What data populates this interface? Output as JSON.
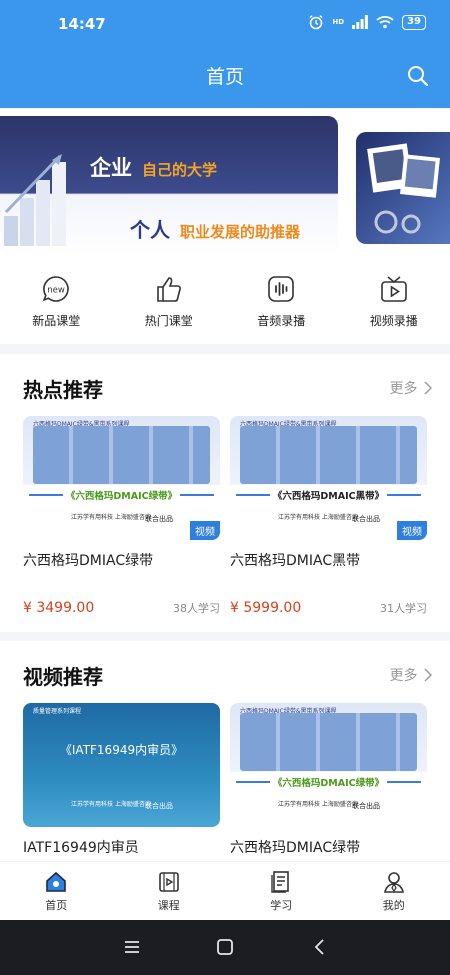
{
  "status_bar": {
    "time": "14:47",
    "battery": "39",
    "signal_label": "HD"
  },
  "header": {
    "title": "首页"
  },
  "banner": {
    "line1_main": "企业",
    "line1_sub": "自己的大学",
    "line2_main": "个人",
    "line2_sub": "职业发展的助推器"
  },
  "quick_menu": [
    {
      "label": "新品课堂",
      "icon": "new-badge-icon",
      "icon_text": "new"
    },
    {
      "label": "热门课堂",
      "icon": "thumbs-up-icon"
    },
    {
      "label": "音频录播",
      "icon": "audio-icon"
    },
    {
      "label": "视频录播",
      "icon": "tv-icon"
    }
  ],
  "hot_section": {
    "title": "热点推荐",
    "more": "更多",
    "items": [
      {
        "thumb_top": "六西格玛DMAIC绿带&黑带系列课程",
        "thumb_name": "《六西格玛DMAIC绿带》",
        "thumb_orgs": "江苏学有用科技 上海励盛咨询",
        "thumb_joint": "联合出品",
        "tag": "视频",
        "title": "六西格玛DMIAC绿带",
        "price": "¥ 3499.00",
        "learners": "38人学习"
      },
      {
        "thumb_top": "六西格玛DMAIC绿带&黑带系列课程",
        "thumb_name": "《六西格玛DMAIC黑带》",
        "thumb_orgs": "江苏学有用科技 上海励盛咨询",
        "thumb_joint": "联合出品",
        "tag": "视频",
        "title": "六西格玛DMIAC黑带",
        "price": "¥ 5999.00",
        "learners": "31人学习"
      }
    ]
  },
  "video_section": {
    "title": "视频推荐",
    "more": "更多",
    "items": [
      {
        "thumb_top": "质量管理系列课程",
        "thumb_name": "《IATF16949内审员》",
        "thumb_orgs": "江苏学有用科技 上海励盛咨询",
        "thumb_joint": "联合出品",
        "title": "IATF16949内审员"
      },
      {
        "thumb_top": "六西格玛DMAIC绿带&黑带系列课程",
        "thumb_name": "《六西格玛DMAIC绿带》",
        "thumb_orgs": "江苏学有用科技 上海励盛咨询",
        "thumb_joint": "联合出品",
        "title": "六西格玛DMIAC绿带"
      }
    ]
  },
  "tabbar": [
    {
      "label": "首页",
      "icon": "home-icon",
      "active": true
    },
    {
      "label": "课程",
      "icon": "course-icon"
    },
    {
      "label": "学习",
      "icon": "study-icon"
    },
    {
      "label": "我的",
      "icon": "profile-icon"
    }
  ],
  "colors": {
    "primary": "#3b97ec",
    "price": "#d9401b",
    "tag": "#2f7fdc"
  }
}
